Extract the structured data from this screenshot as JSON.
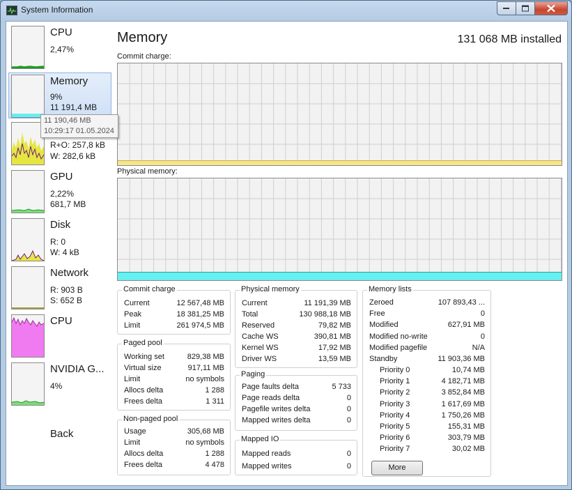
{
  "window": {
    "title": "System Information"
  },
  "sidebar": {
    "items": [
      {
        "title": "CPU",
        "lines": [
          "2,47%"
        ]
      },
      {
        "title": "Memory",
        "lines": [
          "9%",
          "11 191,4 MB"
        ]
      },
      {
        "title": "",
        "lines": [
          "R+O: 257,8 kB",
          "W: 282,6 kB"
        ]
      },
      {
        "title": "GPU",
        "lines": [
          "2,22%",
          "681,7 MB"
        ]
      },
      {
        "title": "Disk",
        "lines": [
          "R: 0",
          "W: 4 kB"
        ]
      },
      {
        "title": "Network",
        "lines": [
          "R: 903 B",
          "S: 652 B"
        ]
      },
      {
        "title": "CPU",
        "lines": []
      },
      {
        "title": "NVIDIA G...",
        "lines": [
          "4%"
        ]
      }
    ],
    "back_label": "Back",
    "tooltip": {
      "value": "11 190,46 MB",
      "time": "10:29:17 01.05.2024"
    }
  },
  "main": {
    "title": "Memory",
    "installed": "131 068 MB installed",
    "commit_graph_label": "Commit charge:",
    "physical_graph_label": "Physical memory:",
    "commit_fill_fraction": 0.096,
    "physical_fill_fraction": 0.085
  },
  "panels": {
    "commit_charge": {
      "title": "Commit charge",
      "rows": [
        {
          "k": "Current",
          "v": "12 567,48 MB"
        },
        {
          "k": "Peak",
          "v": "18 381,25 MB"
        },
        {
          "k": "Limit",
          "v": "261 974,5 MB"
        }
      ]
    },
    "paged_pool": {
      "title": "Paged pool",
      "rows": [
        {
          "k": "Working set",
          "v": "829,38 MB"
        },
        {
          "k": "Virtual size",
          "v": "917,11 MB"
        },
        {
          "k": "Limit",
          "v": "no symbols"
        },
        {
          "k": "Allocs delta",
          "v": "1 288"
        },
        {
          "k": "Frees delta",
          "v": "1 311"
        }
      ]
    },
    "non_paged_pool": {
      "title": "Non-paged pool",
      "rows": [
        {
          "k": "Usage",
          "v": "305,68 MB"
        },
        {
          "k": "Limit",
          "v": "no symbols"
        },
        {
          "k": "Allocs delta",
          "v": "1 288"
        },
        {
          "k": "Frees delta",
          "v": "4 478"
        }
      ]
    },
    "physical_memory": {
      "title": "Physical memory",
      "rows": [
        {
          "k": "Current",
          "v": "11 191,39 MB"
        },
        {
          "k": "Total",
          "v": "130 988,18 MB"
        },
        {
          "k": "Reserved",
          "v": "79,82 MB"
        },
        {
          "k": "Cache WS",
          "v": "390,81 MB"
        },
        {
          "k": "Kernel WS",
          "v": "17,92 MB"
        },
        {
          "k": "Driver WS",
          "v": "13,59 MB"
        }
      ]
    },
    "paging": {
      "title": "Paging",
      "rows": [
        {
          "k": "Page faults delta",
          "v": "5 733"
        },
        {
          "k": "Page reads delta",
          "v": "0"
        },
        {
          "k": "Pagefile writes delta",
          "v": "0"
        },
        {
          "k": "Mapped writes delta",
          "v": "0"
        }
      ]
    },
    "mapped_io": {
      "title": "Mapped IO",
      "rows": [
        {
          "k": "Mapped reads",
          "v": "0"
        },
        {
          "k": "Mapped writes",
          "v": "0"
        }
      ]
    },
    "memory_lists": {
      "title": "Memory lists",
      "rows": [
        {
          "k": "Zeroed",
          "v": "107 893,43 ..."
        },
        {
          "k": "Free",
          "v": "0"
        },
        {
          "k": "Modified",
          "v": "627,91 MB"
        },
        {
          "k": "Modified no-write",
          "v": "0"
        },
        {
          "k": "Modified pagefile",
          "v": "N/A"
        },
        {
          "k": "Standby",
          "v": "11 903,36 MB"
        },
        {
          "k": "Priority 0",
          "v": "10,74 MB"
        },
        {
          "k": "Priority 1",
          "v": "4 182,71 MB"
        },
        {
          "k": "Priority 2",
          "v": "3 852,84 MB"
        },
        {
          "k": "Priority 3",
          "v": "1 617,69 MB"
        },
        {
          "k": "Priority 4",
          "v": "1 750,26 MB"
        },
        {
          "k": "Priority 5",
          "v": "155,31 MB"
        },
        {
          "k": "Priority 6",
          "v": "303,79 MB"
        },
        {
          "k": "Priority 7",
          "v": "30,02 MB"
        }
      ],
      "more_label": "More"
    }
  },
  "colors": {
    "commit_fill": "#f5e68c",
    "physical_fill": "#66f0f0",
    "cpu_graph": "#1f9a1f",
    "io_graph_read": "#e6e642",
    "io_graph_write": "#6a1f7a",
    "cpu2_fill": "#f07af0"
  }
}
